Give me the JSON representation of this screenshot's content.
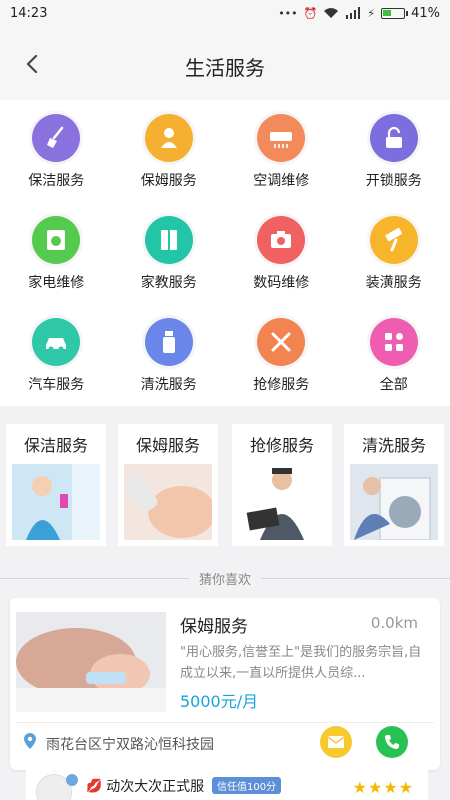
{
  "status_bar": {
    "time": "14:23",
    "battery": "41%",
    "battery_level": 0.41
  },
  "header": {
    "title": "生活服务",
    "back_icon": "chevron-left-icon"
  },
  "services": [
    {
      "label": "保洁服务",
      "icon": "broom-icon",
      "color": "#8a72de"
    },
    {
      "label": "保姆服务",
      "icon": "baby-icon",
      "color": "#f5b032"
    },
    {
      "label": "空调维修",
      "icon": "air-conditioner-icon",
      "color": "#f28a5b"
    },
    {
      "label": "开锁服务",
      "icon": "unlock-icon",
      "color": "#7d6ee0"
    },
    {
      "label": "家电维修",
      "icon": "washing-machine-icon",
      "color": "#56c94f"
    },
    {
      "label": "家教服务",
      "icon": "book-icon",
      "color": "#22c6a6"
    },
    {
      "label": "数码维修",
      "icon": "camera-icon",
      "color": "#f06262"
    },
    {
      "label": "装潢服务",
      "icon": "paint-roller-icon",
      "color": "#f7b52c"
    },
    {
      "label": "汽车服务",
      "icon": "car-icon",
      "color": "#2ec7a8"
    },
    {
      "label": "清洗服务",
      "icon": "spray-bottle-icon",
      "color": "#6a86e8"
    },
    {
      "label": "抢修服务",
      "icon": "tools-icon",
      "color": "#f28452"
    },
    {
      "label": "全部",
      "icon": "all-apps-icon",
      "color": "#ef5db0"
    }
  ],
  "featured": [
    {
      "title": "保洁服务",
      "image": "cleaning-woman-photo"
    },
    {
      "title": "保姆服务",
      "image": "baby-bottle-photo"
    },
    {
      "title": "抢修服务",
      "image": "repair-technician-photo"
    },
    {
      "title": "清洗服务",
      "image": "washing-machine-photo"
    }
  ],
  "recommend_label": "猜你喜欢",
  "listing": {
    "title": "保姆服务",
    "distance": "0.0km",
    "description": "\"用心服务,信誉至上\"是我们的服务宗旨,自成立以来,一直以所提供人员综...",
    "price": "5000元/月",
    "address": "雨花台区宁双路沁恒科技园"
  },
  "listing2": {
    "name": "动次大次正式服",
    "trust": "信任值100分",
    "stars": "★★★★"
  },
  "colors": {
    "accent": "#1aa3d8",
    "call": "#28c254",
    "message": "#f7c92f"
  }
}
